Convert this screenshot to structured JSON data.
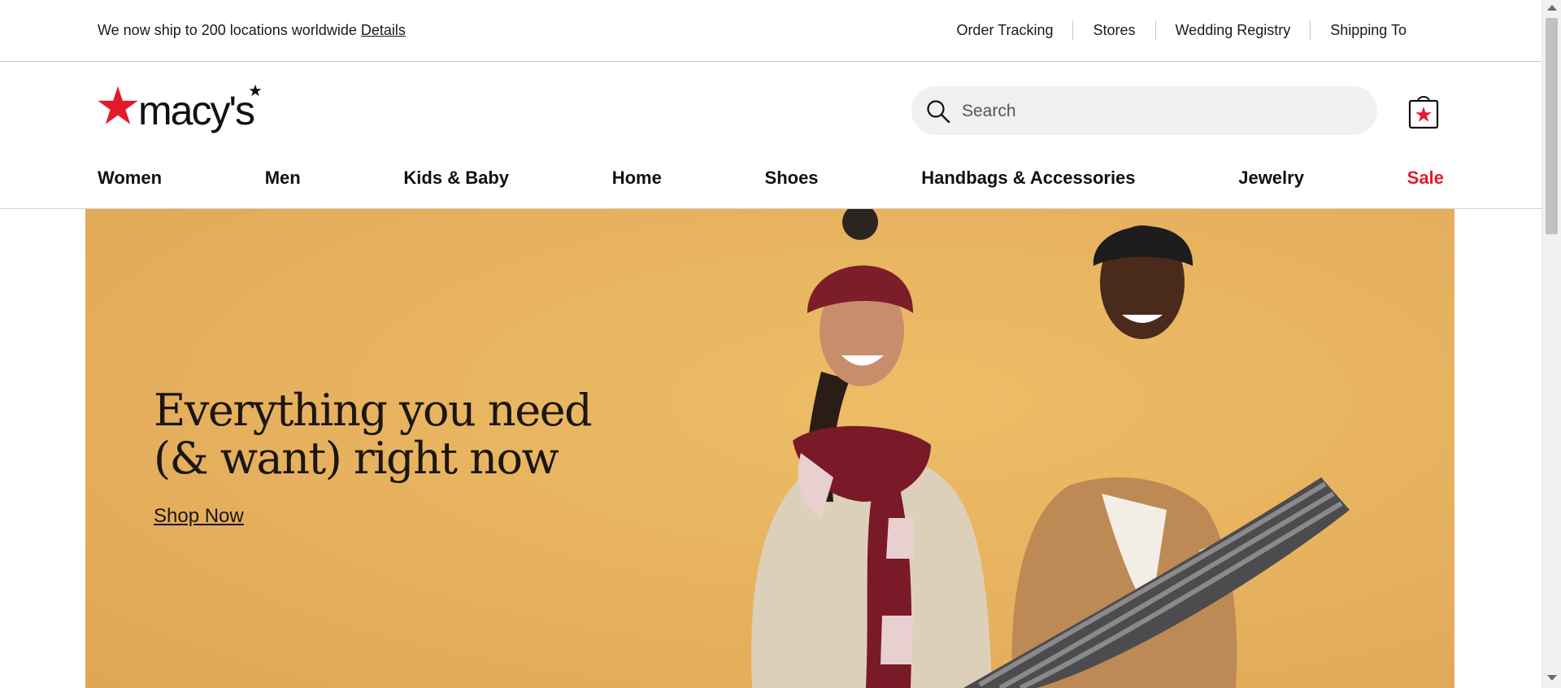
{
  "utility_bar": {
    "ship_message": "We now ship to 200 locations worldwide",
    "details_link": "Details",
    "links": [
      "Order Tracking",
      "Stores",
      "Wedding Registry",
      "Shipping To"
    ]
  },
  "header": {
    "logo_text": "macy's",
    "search_placeholder": "Search",
    "search_value": ""
  },
  "nav": {
    "items": [
      "Women",
      "Men",
      "Kids & Baby",
      "Home",
      "Shoes",
      "Handbags & Accessories",
      "Jewelry",
      "Sale"
    ]
  },
  "hero": {
    "headline_line1": "Everything you need",
    "headline_line2": "(& want) right now",
    "cta": "Shop Now"
  },
  "colors": {
    "brand_red": "#e21a2c",
    "hero_background": "#e6b15e",
    "search_background": "#f0f0f0"
  },
  "icons": {
    "search": "search-icon",
    "bag": "shopping-bag-icon",
    "logo_star": "star-icon"
  }
}
